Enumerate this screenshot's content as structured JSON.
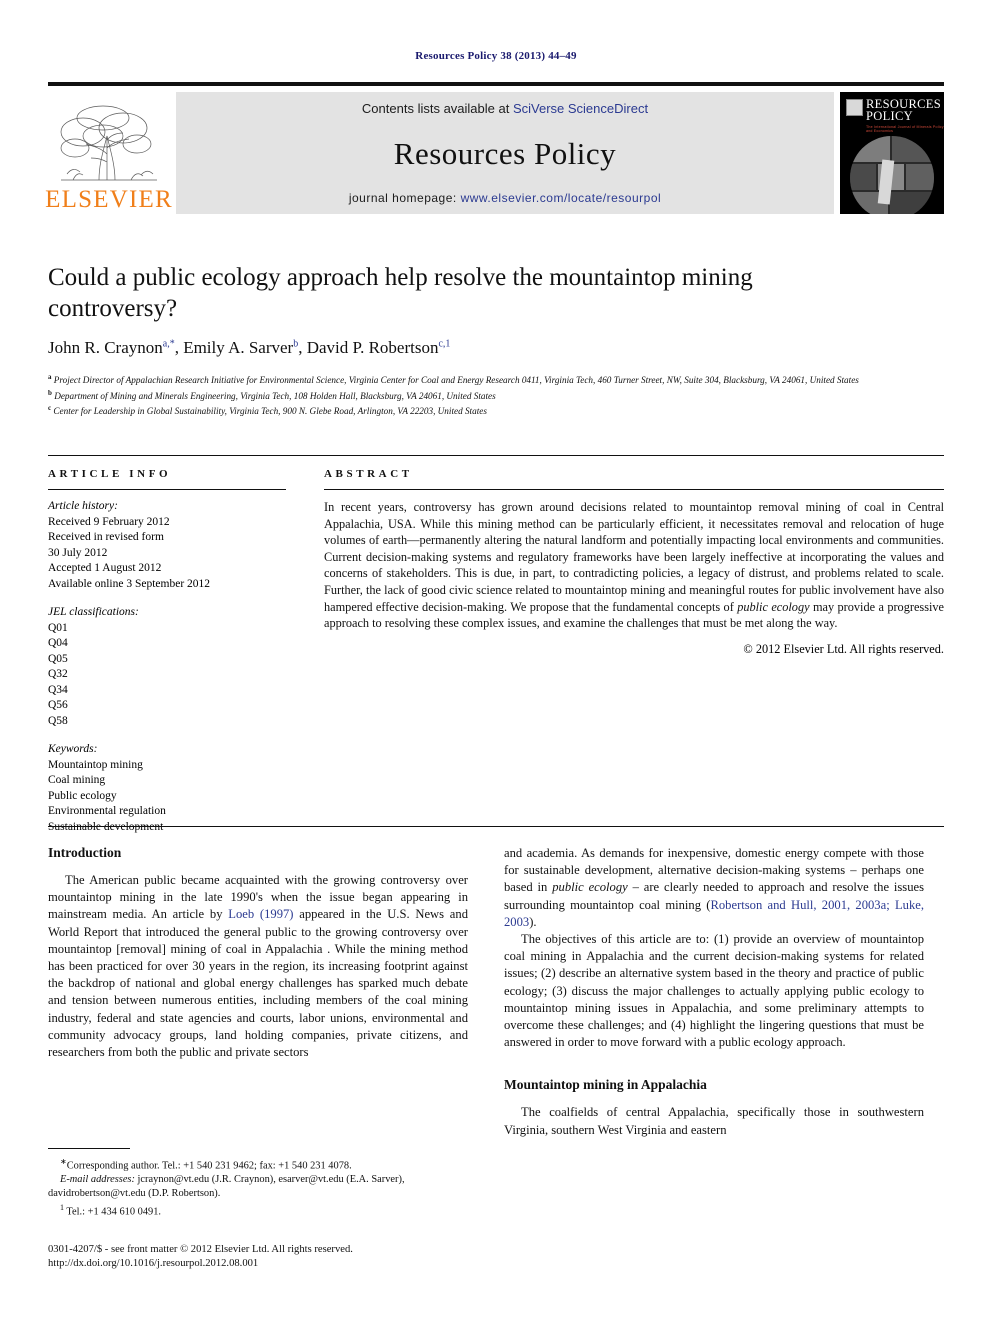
{
  "running_head": "Resources Policy 38 (2013) 44–49",
  "masthead": {
    "contents_prefix": "Contents lists available at ",
    "contents_link": "SciVerse ScienceDirect",
    "journal_name": "Resources Policy",
    "homepage_prefix": "journal homepage: ",
    "homepage_url": "www.elsevier.com/locate/resourpol",
    "publisher_wordmark": "ELSEVIER",
    "cover_title_line1": "RESOURCES",
    "cover_title_line2": "POLICY",
    "cover_subtitle": "The International Journal of Minerals Policy and Economics",
    "accent_orange": "#F07F1A",
    "link_blue": "#2b3a91"
  },
  "article": {
    "title": "Could a public ecology approach help resolve the mountaintop mining controversy?",
    "authors": [
      {
        "name": "John R. Craynon",
        "marks": "a,*"
      },
      {
        "name": "Emily A. Sarver",
        "marks": "b"
      },
      {
        "name": "David P. Robertson",
        "marks": "c,1"
      }
    ],
    "affiliations": [
      {
        "mark": "a",
        "text": "Project Director of Appalachian Research Initiative for Environmental Science, Virginia Center for Coal and Energy Research 0411, Virginia Tech, 460 Turner Street, NW, Suite 304, Blacksburg, VA 24061, United States"
      },
      {
        "mark": "b",
        "text": "Department of Mining and Minerals Engineering, Virginia Tech, 108 Holden Hall, Blacksburg, VA 24061, United States"
      },
      {
        "mark": "c",
        "text": "Center for Leadership in Global Sustainability, Virginia Tech, 900 N. Glebe Road, Arlington, VA 22203, United States"
      }
    ]
  },
  "article_info": {
    "label": "ARTICLE INFO",
    "history_label": "Article history:",
    "history": [
      "Received 9 February 2012",
      "Received in revised form",
      "30 July 2012",
      "Accepted 1 August 2012",
      "Available online 3 September 2012"
    ],
    "jel_label": "JEL classifications:",
    "jel": [
      "Q01",
      "Q04",
      "Q05",
      "Q32",
      "Q34",
      "Q56",
      "Q58"
    ],
    "keywords_label": "Keywords:",
    "keywords": [
      "Mountaintop mining",
      "Coal mining",
      "Public ecology",
      "Environmental regulation",
      "Sustainable development"
    ]
  },
  "abstract": {
    "label": "ABSTRACT",
    "part1": "In recent years, controversy has grown around decisions related to mountaintop removal mining of coal in Central Appalachia, USA. While this mining method can be particularly efficient, it necessitates removal and relocation of huge volumes of earth—permanently altering the natural landform and potentially impacting local environments and communities. Current decision-making systems and regulatory frameworks have been largely ineffective at incorporating the values and concerns of stakeholders. This is due, in part, to contradicting policies, a legacy of distrust, and problems related to scale. Further, the lack of good civic science related to mountaintop mining and meaningful routes for public involvement have also hampered effective decision-making. We propose that the fundamental concepts of ",
    "emphasis": "public ecology",
    "part2": " may provide a progressive approach to resolving these complex issues, and examine the challenges that must be met along the way.",
    "copyright": "© 2012 Elsevier Ltd. All rights reserved."
  },
  "body": {
    "left": {
      "heading": "Introduction",
      "para1_a": "The American public became acquainted with the growing controversy over mountaintop mining in the late 1990's when the issue began appearing in mainstream media. An article by ",
      "para1_ref": "Loeb (1997)",
      "para1_b": " appeared in the U.S. News and World Report that introduced the general public to the growing controversy over mountaintop [removal] mining of coal in Appalachia . While the mining method has been practiced for over 30 years in the region, its increasing footprint against the backdrop of national and global energy challenges has sparked much debate and tension between numerous entities, including members of the coal mining industry, federal and state agencies and courts, labor unions, environmental and community advocacy groups, land holding companies, private citizens, and researchers from both the public and private sectors"
    },
    "right": {
      "para1_a": "and academia. As demands for inexpensive, domestic energy compete with those for sustainable development, alternative decision-making systems – perhaps one based in ",
      "para1_em": "public ecology",
      "para1_b": " – are clearly needed to approach and resolve the issues surrounding mountaintop coal mining (",
      "para1_ref": "Robertson and Hull, 2001, 2003a; Luke, 2003",
      "para1_c": ").",
      "para2": "The objectives of this article are to: (1) provide an overview of mountaintop coal mining in Appalachia and the current decision-making systems for related issues; (2) describe an alternative system based in the theory and practice of public ecology; (3) discuss the major challenges to actually applying public ecology to mountaintop mining issues in Appalachia, and some preliminary attempts to overcome these challenges; and (4) highlight the lingering questions that must be answered in order to move forward with a public ecology approach.",
      "heading2": "Mountaintop mining in Appalachia",
      "para3": "The coalfields of central Appalachia, specifically those in southwestern Virginia, southern West Virginia and eastern"
    }
  },
  "footnotes": {
    "corresponding": "Corresponding author. Tel.: +1 540 231 9462; fax: +1 540 231 4078.",
    "email_label": "E-mail addresses:",
    "emails": "jcraynon@vt.edu (J.R. Craynon), esarver@vt.edu (E.A. Sarver), davidrobertson@vt.edu (D.P. Robertson).",
    "note1_mark": "1",
    "note1": "Tel.: +1 434 610 0491."
  },
  "imprint": {
    "line1": "0301-4207/$ - see front matter © 2012 Elsevier Ltd. All rights reserved.",
    "line2": "http://dx.doi.org/10.1016/j.resourpol.2012.08.001"
  }
}
